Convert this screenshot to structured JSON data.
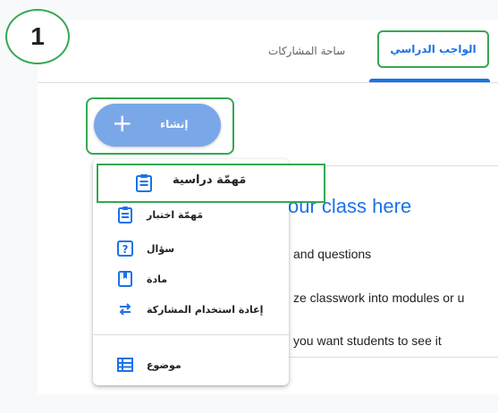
{
  "tabs": {
    "stream": "ساحة المشاركات",
    "classwork": "الواجب الدراسي"
  },
  "step_number": "1",
  "create_button": {
    "label": "إنشاء",
    "icon": "plus-icon"
  },
  "menu": {
    "items": [
      {
        "label": "مَهمّة دراسية",
        "icon": "assignment-icon"
      },
      {
        "label": "مَهمّة اختبار",
        "icon": "quiz-assignment-icon"
      },
      {
        "label": "سؤال",
        "icon": "question-icon"
      },
      {
        "label": "مادة",
        "icon": "material-icon"
      },
      {
        "label": "إعادة استخدام المشاركة",
        "icon": "reuse-post-icon"
      },
      {
        "label": "موضوع",
        "icon": "topic-icon"
      }
    ]
  },
  "card": {
    "title": "our class here",
    "line1": "and questions",
    "line2": "ze classwork into modules or u",
    "line3": "you want students to see it"
  },
  "colors": {
    "accent": "#1a73e8",
    "highlight": "#34a853",
    "create_button": "#7aa7e8"
  }
}
